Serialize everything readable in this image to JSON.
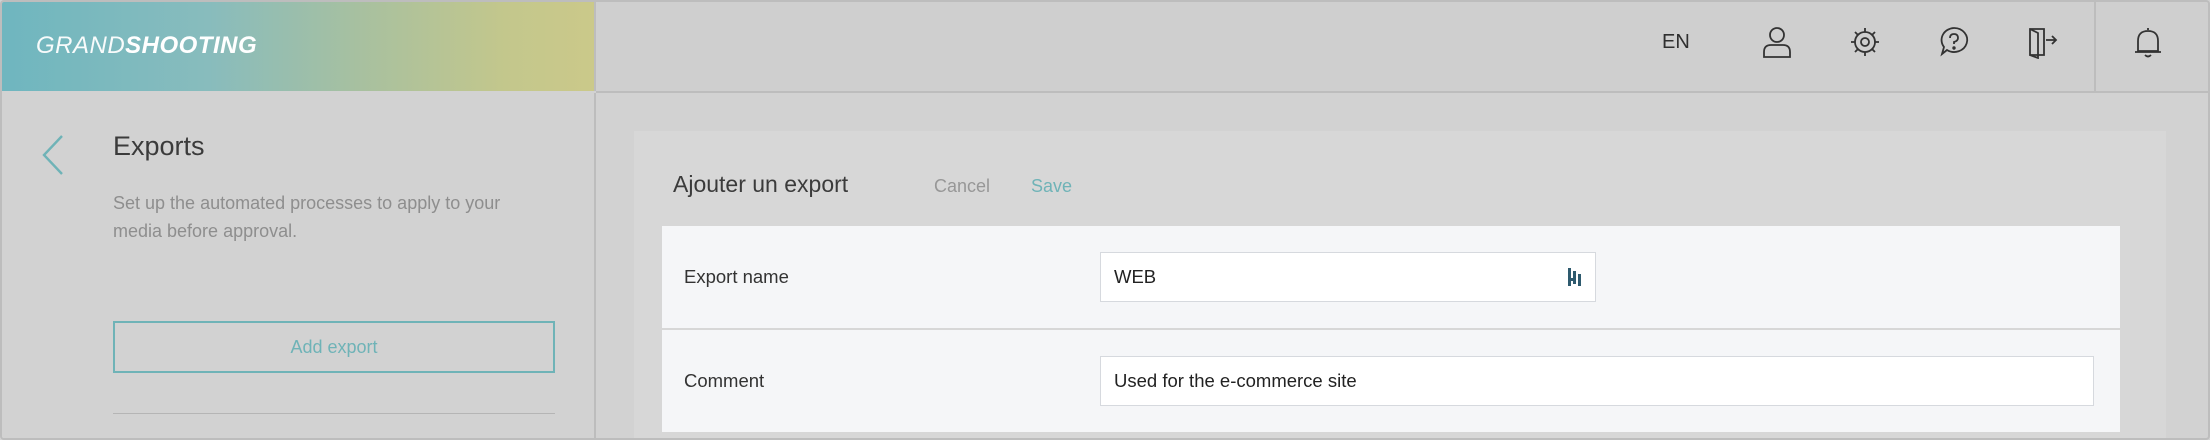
{
  "brand": {
    "logo_light": "GRAND",
    "logo_bold": "SHOOTING"
  },
  "header": {
    "language": "EN",
    "icons": [
      "user-icon",
      "settings-icon",
      "help-icon",
      "logout-icon",
      "bell-icon"
    ]
  },
  "sidebar": {
    "title": "Exports",
    "description": "Set up the automated processes to apply to your media before approval.",
    "add_button": "Add export"
  },
  "form": {
    "title": "Ajouter un export",
    "cancel_label": "Cancel",
    "save_label": "Save",
    "fields": [
      {
        "label": "Export name",
        "value": "WEB"
      },
      {
        "label": "Comment",
        "value": "Used for the e-commerce site"
      }
    ]
  },
  "colors": {
    "accent": "#6fb3b7",
    "overlay_bg": "#d2d2d2",
    "form_row_bg": "#f5f6f8"
  }
}
